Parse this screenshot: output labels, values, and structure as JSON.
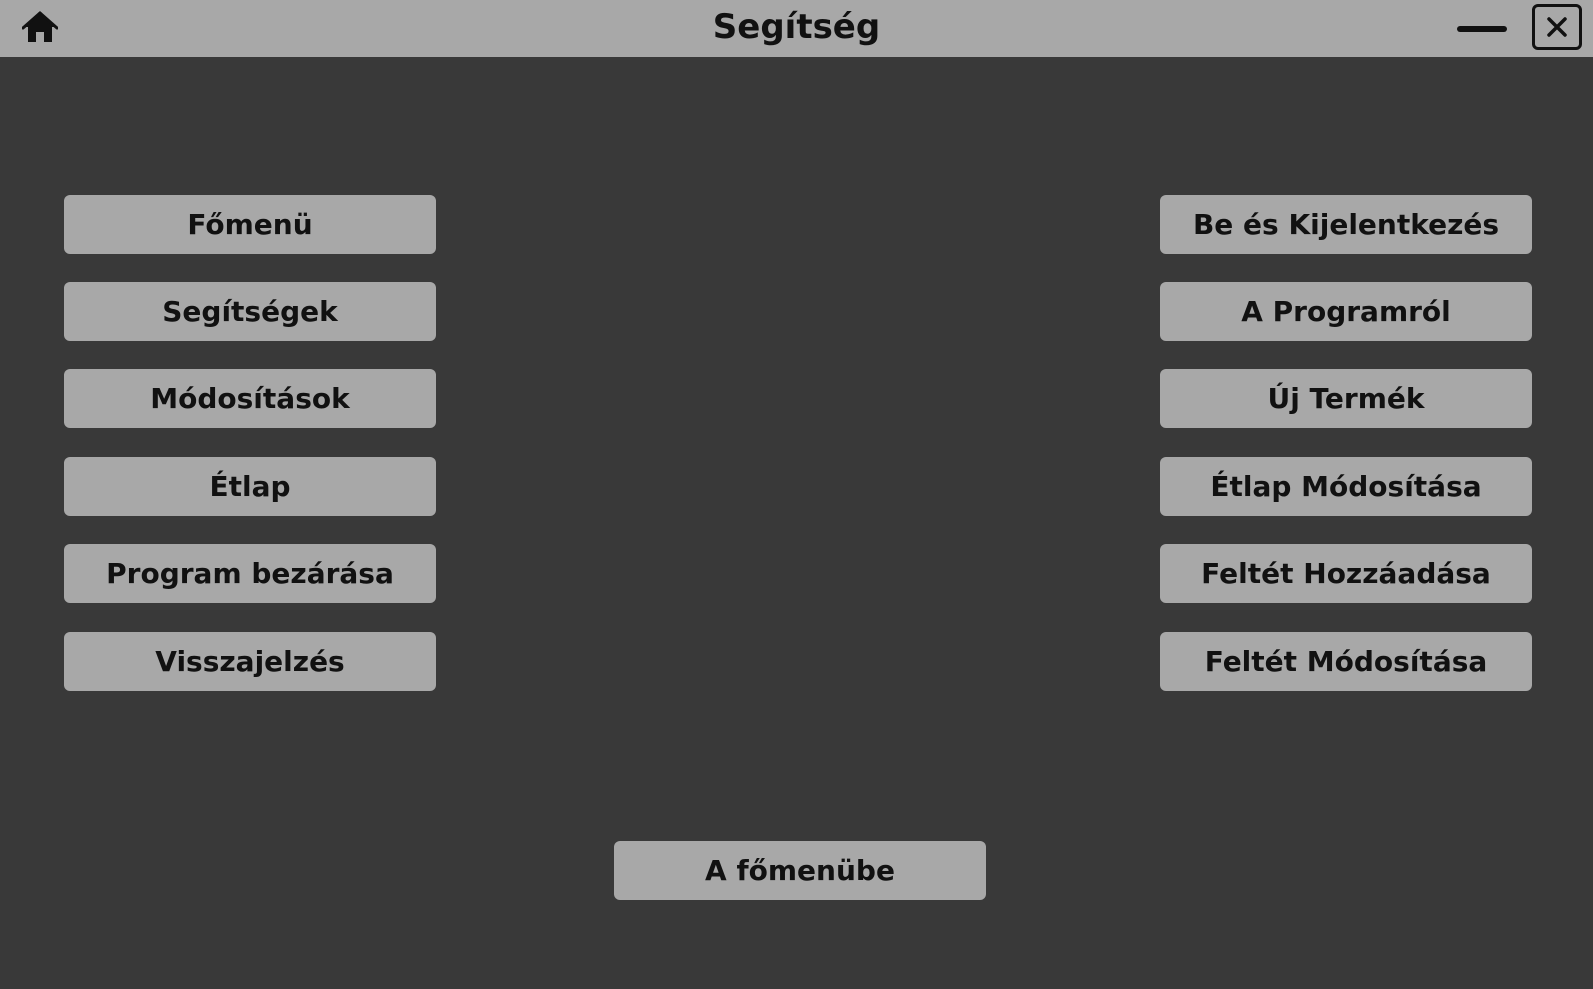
{
  "window": {
    "title": "Segítség"
  },
  "icons": {
    "home": "home-icon",
    "minimize": "minimize-icon",
    "close": "close-icon"
  },
  "colors": {
    "background": "#393939",
    "titlebar": "#a8a8a8",
    "button": "#a8a8a8",
    "text": "#111111"
  },
  "left_menu": [
    {
      "label": "Főmenü"
    },
    {
      "label": "Segítségek"
    },
    {
      "label": "Módosítások"
    },
    {
      "label": "Étlap"
    },
    {
      "label": "Program bezárása"
    },
    {
      "label": "Visszajelzés"
    }
  ],
  "right_menu": [
    {
      "label": "Be és Kijelentkezés"
    },
    {
      "label": "A Programról"
    },
    {
      "label": "Új Termék"
    },
    {
      "label": "Étlap Módosítása"
    },
    {
      "label": "Feltét Hozzáadása"
    },
    {
      "label": "Feltét Módosítása"
    }
  ],
  "back_button": {
    "label": "A főmenübe"
  }
}
